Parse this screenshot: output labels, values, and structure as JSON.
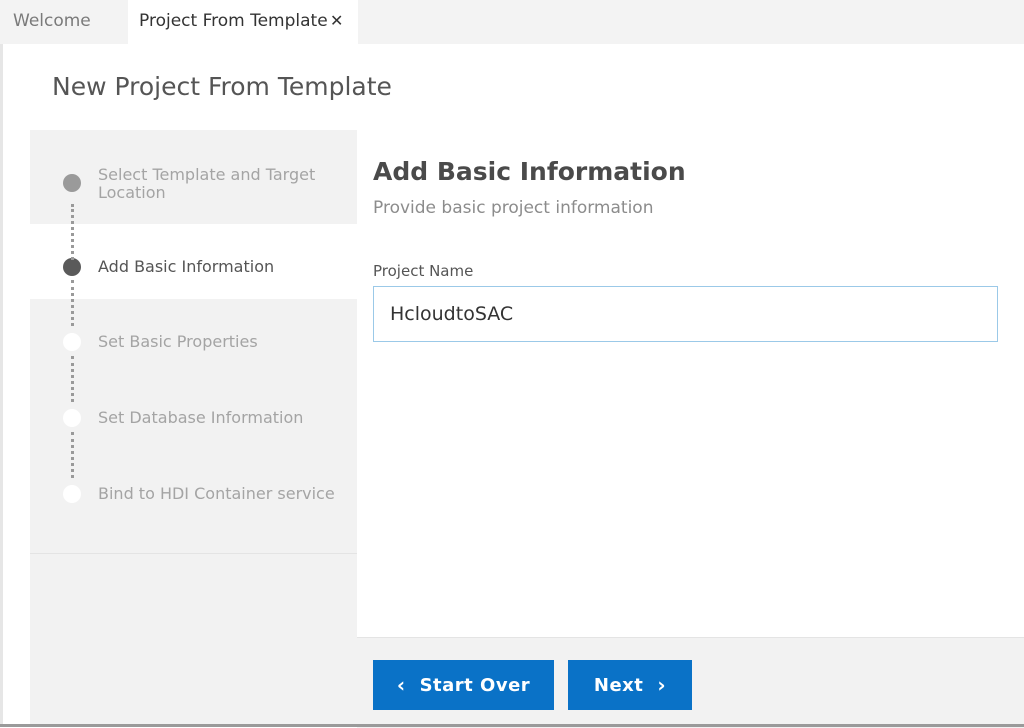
{
  "tabs": [
    {
      "label": "Welcome",
      "active": false
    },
    {
      "label": "Project From Template",
      "active": true,
      "close_glyph": "✕"
    }
  ],
  "page": {
    "title": "New Project From Template"
  },
  "wizard": {
    "steps": [
      {
        "label": "Select Template and Target Location",
        "state": "done"
      },
      {
        "label": "Add Basic Information",
        "state": "current"
      },
      {
        "label": "Set Basic Properties",
        "state": "todo"
      },
      {
        "label": "Set Database Information",
        "state": "todo"
      },
      {
        "label": "Bind to HDI Container service",
        "state": "todo"
      }
    ]
  },
  "main": {
    "title": "Add Basic Information",
    "subtitle": "Provide basic project information",
    "project_name_label": "Project Name",
    "project_name_value": "HcloudtoSAC"
  },
  "footer": {
    "start_over_label": "Start Over",
    "next_label": "Next",
    "start_over_icon": "chevron-left-icon",
    "next_icon": "chevron-right-icon"
  },
  "colors": {
    "primary_button": "#0a72c7",
    "input_border": "#9bc9e8",
    "sidebar_bg": "#f2f2f2"
  }
}
